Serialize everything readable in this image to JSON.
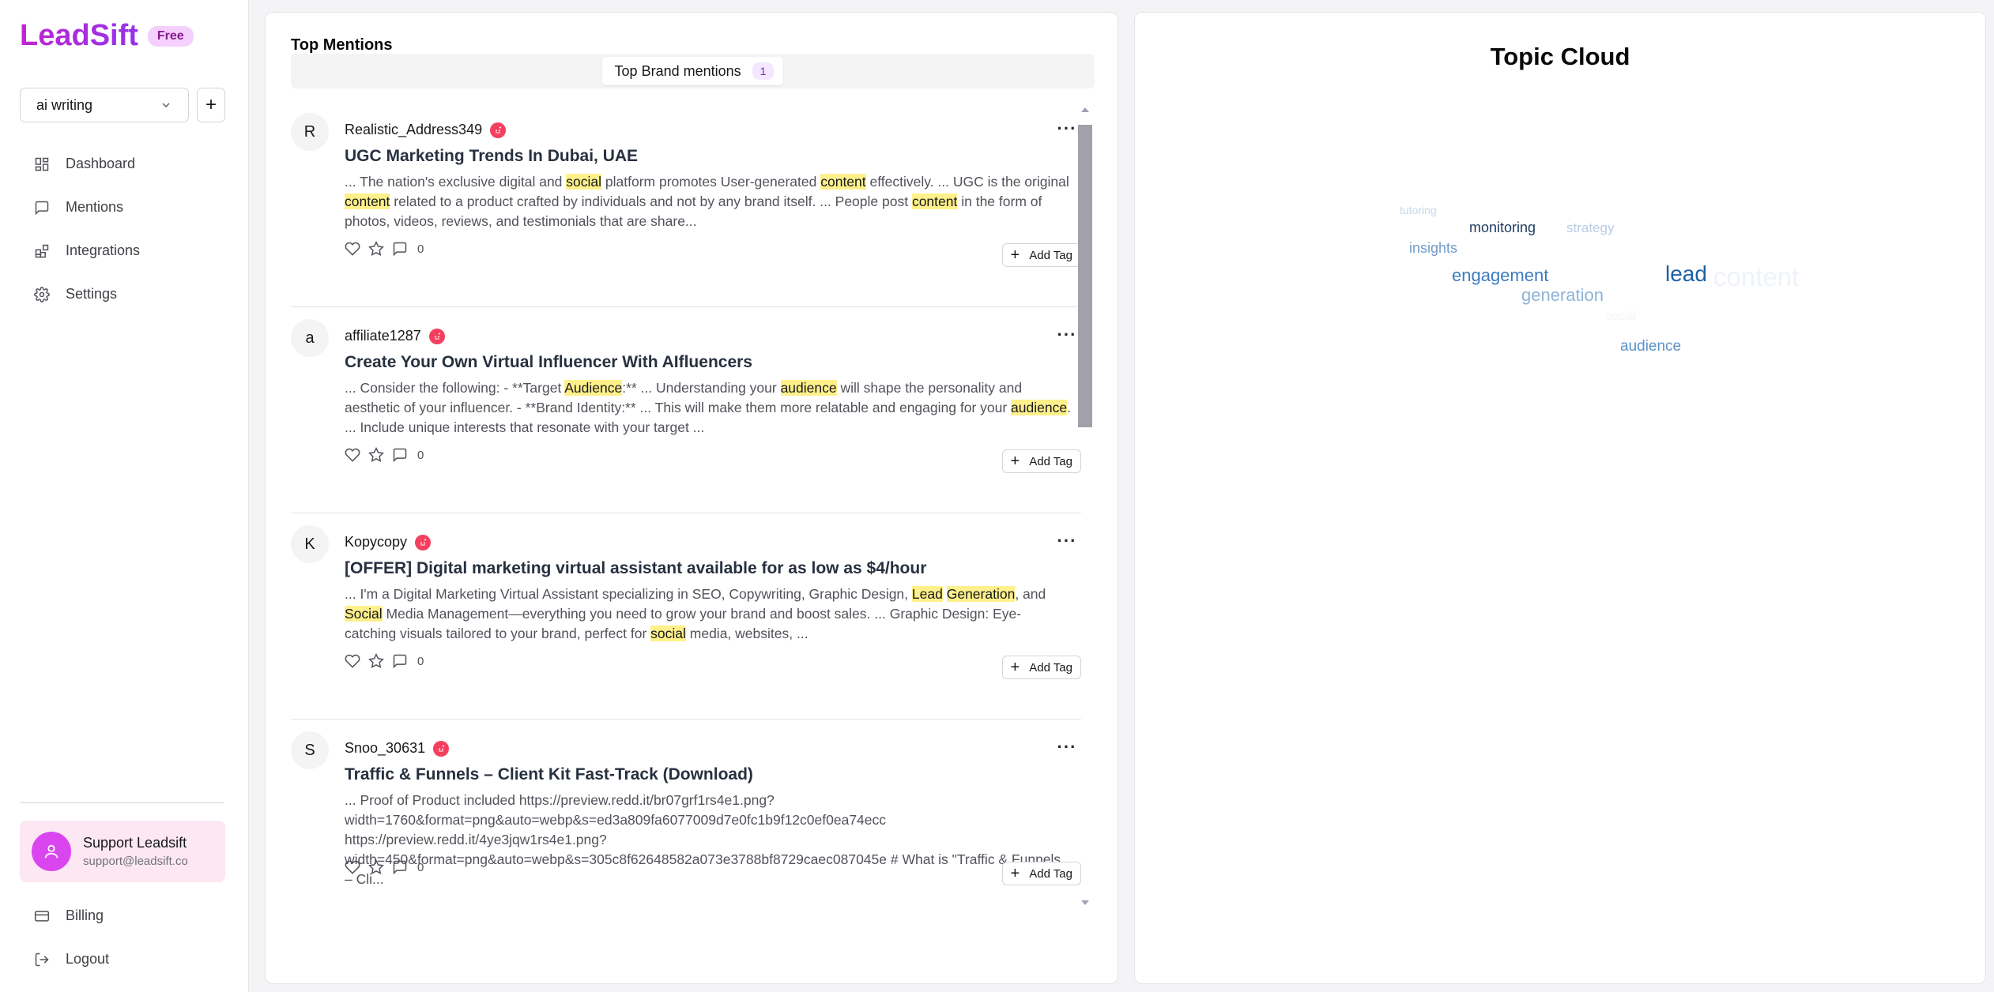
{
  "app": {
    "name": "LeadSift",
    "plan_badge": "Free"
  },
  "project": {
    "selected": "ai writing",
    "add_label": "+"
  },
  "nav": {
    "items": [
      {
        "label": "Dashboard",
        "icon": "dashboard-icon"
      },
      {
        "label": "Mentions",
        "icon": "message-icon"
      },
      {
        "label": "Integrations",
        "icon": "integrations-icon"
      },
      {
        "label": "Settings",
        "icon": "gear-icon"
      }
    ]
  },
  "support": {
    "name": "Support Leadsift",
    "email": "support@leadsift.co"
  },
  "bottom_nav": {
    "billing": "Billing",
    "logout": "Logout"
  },
  "mentions_panel": {
    "title": "Top Mentions",
    "tab_label": "Top Brand mentions",
    "tab_count": "1",
    "add_tag_label": "Add Tag",
    "items": [
      {
        "initial": "R",
        "author": "Realistic_Address349",
        "source_icon": "reddit-icon",
        "title": "UGC Marketing Trends In Dubai, UAE",
        "snippet": [
          {
            "t": "... The nation's exclusive digital and "
          },
          {
            "t": "social",
            "hl": true
          },
          {
            "t": " platform promotes User-generated "
          },
          {
            "t": "content",
            "hl": true
          },
          {
            "t": " effectively. ... UGC is the original "
          },
          {
            "t": "content",
            "hl": true
          },
          {
            "t": " related to a product crafted by individuals and not by any brand itself. ... People post "
          },
          {
            "t": "content",
            "hl": true
          },
          {
            "t": " in the form of photos, videos, reviews, and testimonials that are share..."
          }
        ],
        "comments": "0"
      },
      {
        "initial": "a",
        "author": "affiliate1287",
        "source_icon": "reddit-icon",
        "title": "Create Your Own Virtual Influencer With AIfluencers",
        "snippet": [
          {
            "t": "... Consider the following: - **Target "
          },
          {
            "t": "Audience",
            "hl": true
          },
          {
            "t": ":** ... Understanding your "
          },
          {
            "t": "audience",
            "hl": true
          },
          {
            "t": " will shape the personality and aesthetic of your influencer. - **Brand Identity:** ... This will make them more relatable and engaging for your "
          },
          {
            "t": "audience",
            "hl": true
          },
          {
            "t": ". ... Include unique interests that resonate with your target ..."
          }
        ],
        "comments": "0"
      },
      {
        "initial": "K",
        "author": "Kopycopy",
        "source_icon": "reddit-icon",
        "title": "[OFFER] Digital marketing virtual assistant available for as low as $4/hour",
        "snippet": [
          {
            "t": "... I'm a Digital Marketing Virtual Assistant specializing in SEO, Copywriting, Graphic Design, "
          },
          {
            "t": "Lead",
            "hl": true
          },
          {
            "t": " "
          },
          {
            "t": "Generation",
            "hl": true
          },
          {
            "t": ", and "
          },
          {
            "t": "Social",
            "hl": true
          },
          {
            "t": " Media Management—everything you need to grow your brand and boost sales. ... Graphic Design: Eye-catching visuals tailored to your brand, perfect for "
          },
          {
            "t": "social",
            "hl": true
          },
          {
            "t": " media, websites, ..."
          }
        ],
        "comments": "0"
      },
      {
        "initial": "S",
        "author": "Snoo_30631",
        "source_icon": "reddit-icon",
        "title": "Traffic & Funnels – Client Kit Fast-Track (Download)",
        "snippet": [
          {
            "t": "... Proof of Product included https://preview.redd.it/br07grf1rs4e1.png?\nwidth=1760&format=png&auto=webp&s=ed3a809fa6077009d7e0fc1b9f12c0ef0ea74ecc\nhttps://preview.redd.it/4ye3jqw1rs4e1.png?\nwidth=450&format=png&auto=webp&s=305c8f62648582a073e3788bf8729caec087045e # What is \"Traffic & Funnels – Cli..."
          }
        ],
        "comments": "0"
      }
    ]
  },
  "topic_cloud": {
    "title": "Topic Cloud",
    "words": [
      {
        "text": "tutoring",
        "weight": 0.15,
        "color": "#c7d7ea"
      },
      {
        "text": "monitoring",
        "weight": 0.3,
        "color": "#1e3a5f"
      },
      {
        "text": "strategy",
        "weight": 0.25,
        "color": "#b6cce4"
      },
      {
        "text": "insights",
        "weight": 0.3,
        "color": "#6f9cca"
      },
      {
        "text": "engagement",
        "weight": 0.45,
        "color": "#3d7bbf"
      },
      {
        "text": "lead",
        "weight": 0.7,
        "color": "#1d5fa8"
      },
      {
        "text": "content",
        "weight": 0.9,
        "color": "#eef3f9"
      },
      {
        "text": "generation",
        "weight": 0.45,
        "color": "#8fb3d8"
      },
      {
        "text": "social",
        "weight": 0.2,
        "color": "#f1f5f9"
      },
      {
        "text": "audience",
        "weight": 0.35,
        "color": "#5d93c9"
      }
    ]
  }
}
